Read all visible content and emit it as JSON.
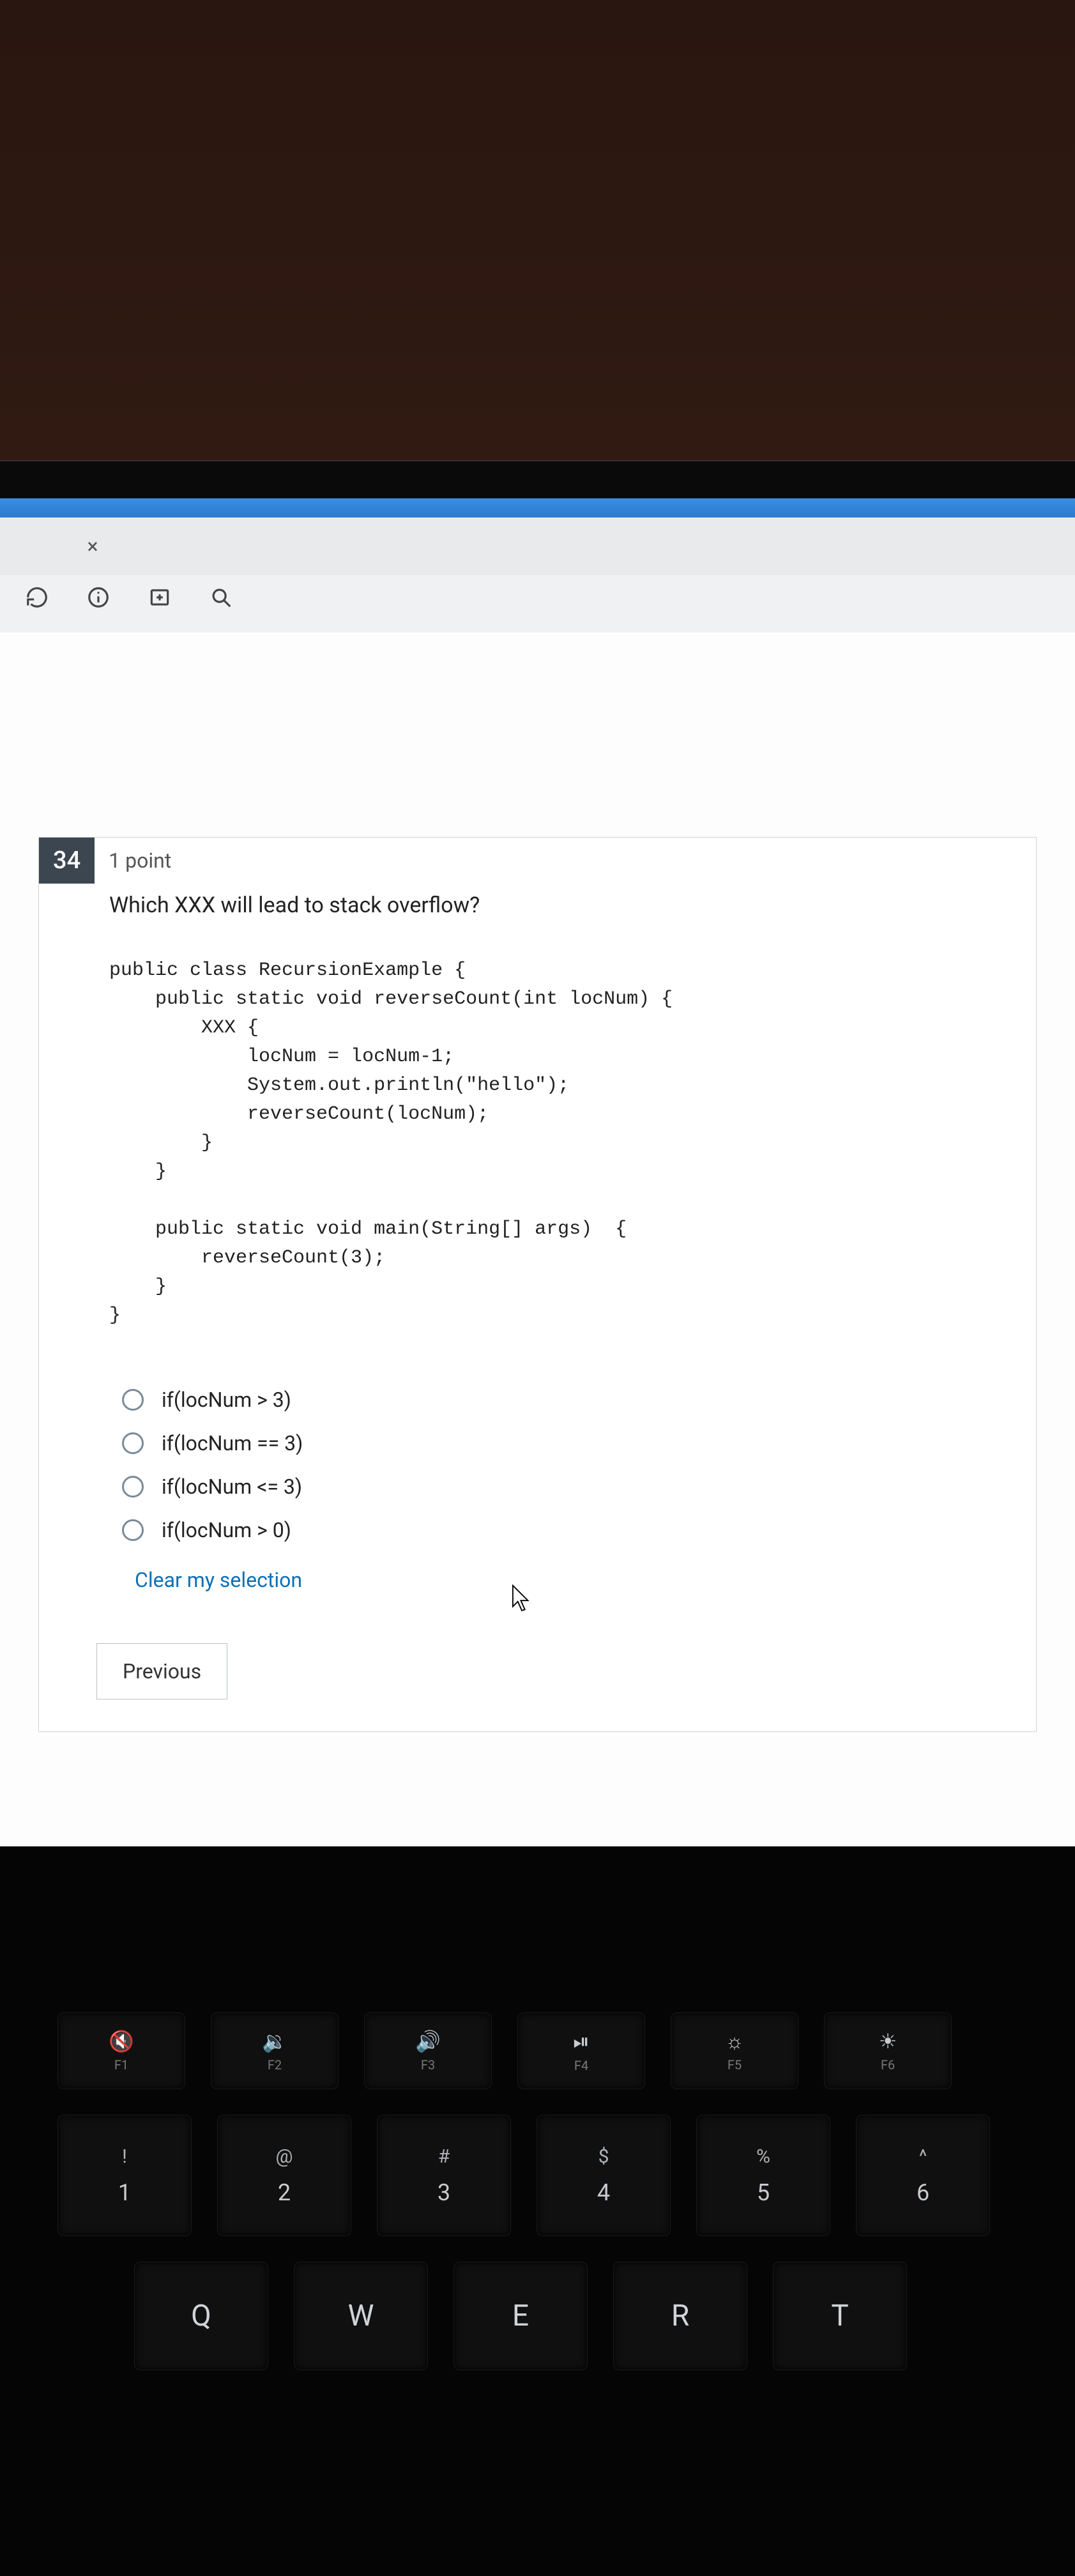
{
  "toolbar": {
    "close_tab": "×"
  },
  "question": {
    "number": "34",
    "points": "1 point",
    "prompt": "Which XXX will lead to stack overflow?",
    "code": "public class RecursionExample {\n    public static void reverseCount(int locNum) {\n        XXX {\n            locNum = locNum-1;\n            System.out.println(\"hello\");\n            reverseCount(locNum);\n        }\n    }\n\n    public static void main(String[] args)  {\n        reverseCount(3);\n    }\n}",
    "options": [
      "if(locNum > 3)",
      "if(locNum == 3)",
      "if(locNum <= 3)",
      "if(locNum > 0)"
    ],
    "clear_label": "Clear my selection",
    "previous_label": "Previous"
  },
  "keyboard": {
    "fn": [
      {
        "icon": "🔇",
        "label": "F1"
      },
      {
        "icon": "🔉",
        "label": "F2"
      },
      {
        "icon": "🔊",
        "label": "F3"
      },
      {
        "icon": "⏯",
        "label": "F4"
      },
      {
        "icon": "☼",
        "label": "F5"
      },
      {
        "icon": "☀",
        "label": "F6"
      }
    ],
    "num": [
      {
        "sym": "!",
        "num": "1"
      },
      {
        "sym": "@",
        "num": "2"
      },
      {
        "sym": "#",
        "num": "3"
      },
      {
        "sym": "$",
        "num": "4"
      },
      {
        "sym": "%",
        "num": "5"
      },
      {
        "sym": "^",
        "num": "6"
      }
    ],
    "letters": [
      "Q",
      "W",
      "E",
      "R",
      "T"
    ]
  }
}
